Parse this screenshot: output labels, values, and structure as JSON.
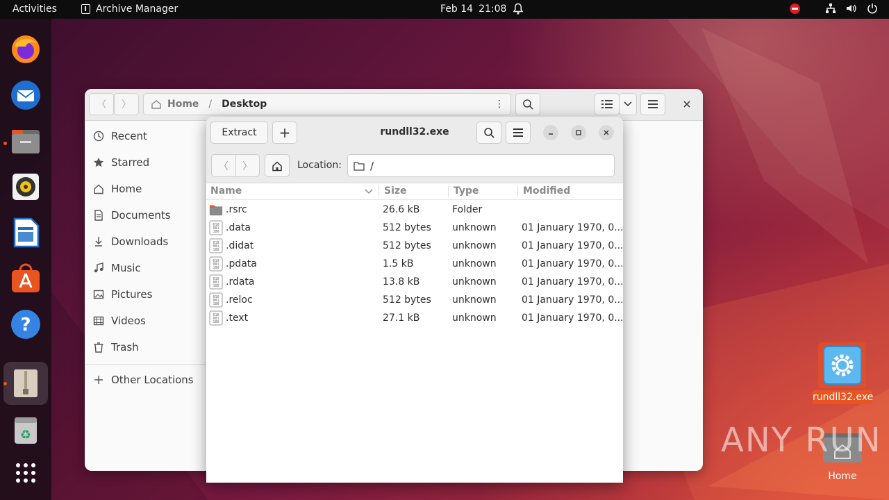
{
  "topbar": {
    "activities": "Activities",
    "app_name": "Archive Manager",
    "date": "Feb 14",
    "time": "21:08"
  },
  "dock": {
    "items": [
      "firefox",
      "thunderbird",
      "files",
      "rhythmbox",
      "libreoffice-writer",
      "app-center",
      "help",
      "archive-manager",
      "trash",
      "show-apps"
    ]
  },
  "files_window": {
    "path_home": "Home",
    "path_current": "Desktop",
    "sidebar": [
      {
        "label": "Recent",
        "icon": "clock-icon"
      },
      {
        "label": "Starred",
        "icon": "star-icon"
      },
      {
        "label": "Home",
        "icon": "home-icon"
      },
      {
        "label": "Documents",
        "icon": "document-icon"
      },
      {
        "label": "Downloads",
        "icon": "download-icon"
      },
      {
        "label": "Music",
        "icon": "music-icon"
      },
      {
        "label": "Pictures",
        "icon": "picture-icon"
      },
      {
        "label": "Videos",
        "icon": "video-icon"
      },
      {
        "label": "Trash",
        "icon": "trash-icon"
      }
    ],
    "other_locations": "Other Locations"
  },
  "archive_window": {
    "title": "rundll32.exe",
    "extract_label": "Extract",
    "add_label": "+",
    "location_label": "Location:",
    "location_value": "/",
    "columns": {
      "name": "Name",
      "size": "Size",
      "type": "Type",
      "modified": "Modified"
    },
    "rows": [
      {
        "name": ".rsrc",
        "size": "26.6 kB",
        "type": "Folder",
        "modified": "",
        "kind": "folder"
      },
      {
        "name": ".data",
        "size": "512 bytes",
        "type": "unknown",
        "modified": "01 January 1970, 0...",
        "kind": "binary"
      },
      {
        "name": ".didat",
        "size": "512 bytes",
        "type": "unknown",
        "modified": "01 January 1970, 0...",
        "kind": "binary"
      },
      {
        "name": ".pdata",
        "size": "1.5 kB",
        "type": "unknown",
        "modified": "01 January 1970, 0...",
        "kind": "binary"
      },
      {
        "name": ".rdata",
        "size": "13.8 kB",
        "type": "unknown",
        "modified": "01 January 1970, 0...",
        "kind": "binary"
      },
      {
        "name": ".reloc",
        "size": "512 bytes",
        "type": "unknown",
        "modified": "01 January 1970, 0...",
        "kind": "binary"
      },
      {
        "name": ".text",
        "size": "27.1 kB",
        "type": "unknown",
        "modified": "01 January 1970, 0...",
        "kind": "binary"
      }
    ]
  },
  "desktop": {
    "exe_label": "rundll32.exe",
    "home_label": "Home",
    "watermark": "ANY RUN"
  },
  "colors": {
    "accent": "#e95420",
    "topbar": "#0d0d0d",
    "window_header": "#ebebeb"
  }
}
